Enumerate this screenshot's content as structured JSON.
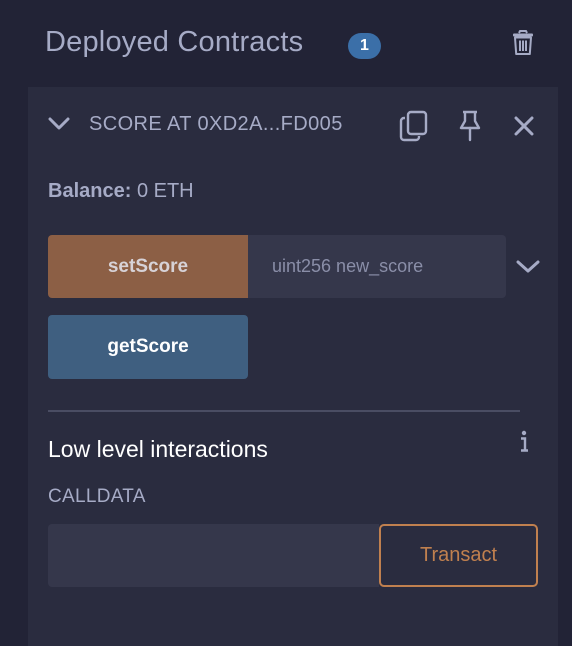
{
  "header": {
    "title": "Deployed Contracts",
    "count": "1",
    "trash_icon": "trash-icon"
  },
  "contract": {
    "title": "SCORE AT 0XD2A...FD005",
    "toggle_icon": "chevron-down-icon",
    "copy_icon": "copy-icon",
    "pin_icon": "pin-icon",
    "close_icon": "close-icon",
    "balance_label": "Balance:",
    "balance_value": "0 ETH",
    "functions": {
      "set": {
        "label": "setScore",
        "placeholder": "uint256 new_score",
        "value": ""
      },
      "get": {
        "label": "getScore"
      }
    }
  },
  "low_level": {
    "title": "Low level interactions",
    "info_icon": "info-icon",
    "calldata_label": "CALLDATA",
    "calldata_value": "",
    "transact_label": "Transact"
  },
  "colors": {
    "background": "#222336",
    "panel": "#2a2c3f",
    "badge": "#3b6fa8",
    "set_button": "#8c5f45",
    "get_button": "#3f5f80",
    "transact_accent": "#c0804f",
    "muted_text": "#a6abc6"
  }
}
